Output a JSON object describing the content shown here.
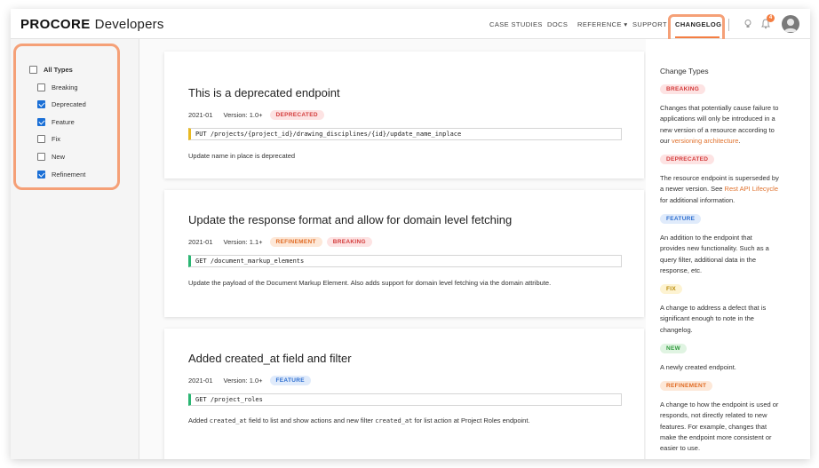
{
  "header": {
    "brand": "PROCORE",
    "brand_suffix": "Developers",
    "nav": [
      "CASE STUDIES",
      "DOCS",
      "REFERENCE ▾",
      "SUPPORT",
      "CHANGELOG"
    ],
    "notification_count": "4"
  },
  "sidebar": {
    "all_label": "All Types",
    "filters": [
      {
        "label": "Breaking",
        "checked": false
      },
      {
        "label": "Deprecated",
        "checked": true
      },
      {
        "label": "Feature",
        "checked": true
      },
      {
        "label": "Fix",
        "checked": false
      },
      {
        "label": "New",
        "checked": false
      },
      {
        "label": "Refinement",
        "checked": true
      }
    ]
  },
  "entries": [
    {
      "title": "This is a deprecated endpoint",
      "date": "2021-01",
      "version": "Version: 1.0+",
      "badges": [
        "DEPRECATED"
      ],
      "code": "PUT /projects/{project_id}/drawing_disciplines/{id}/update_name_inplace",
      "description": "Update name in place is deprecated"
    },
    {
      "title": "Update the response format and allow for domain level fetching",
      "date": "2021-01",
      "version": "Version: 1.1+",
      "badges": [
        "REFINEMENT",
        "BREAKING"
      ],
      "code": "GET /document_markup_elements",
      "description": "Update the payload of the Document Markup Element. Also adds support for domain level fetching via the domain attribute."
    },
    {
      "title": "Added created_at field and filter",
      "date": "2021-01",
      "version": "Version: 1.0+",
      "badges": [
        "FEATURE"
      ],
      "code": "GET /project_roles",
      "description_parts": [
        "Added ",
        "created_at",
        " field to list and show actions and new filter ",
        "created_at",
        " for list action at Project Roles endpoint."
      ]
    }
  ],
  "change_types": {
    "title": "Change Types",
    "items": [
      {
        "badge": "BREAKING",
        "text_lines": [
          "Changes that potentially cause failure to",
          "applications will only be introduced in a",
          "new version of a resource according to"
        ],
        "last_prefix": "our ",
        "link": "versioning architecture",
        "last_suffix": "."
      },
      {
        "badge": "DEPRECATED",
        "text_lines": [
          "The resource endpoint is superseded by"
        ],
        "last_prefix": "a newer version. See ",
        "link": "Rest API Lifecycle",
        "last_suffix": "",
        "after_line": "for additional information."
      },
      {
        "badge": "FEATURE",
        "text_lines": [
          "An addition to the endpoint that",
          "provides new functionality. Such as a",
          "query filter, additional data in the",
          "response, etc."
        ]
      },
      {
        "badge": "FIX",
        "text_lines": [
          "A change to address a defect that is",
          "significant enough to note in the",
          "changelog."
        ]
      },
      {
        "badge": "NEW",
        "text_lines": [
          "A newly created endpoint."
        ]
      },
      {
        "badge": "REFINEMENT",
        "text_lines": [
          "A change to how the endpoint is used or",
          "responds, not directly related to new",
          "features. For example, changes that",
          "make the endpoint more consistent or",
          "easier to use."
        ]
      }
    ]
  }
}
